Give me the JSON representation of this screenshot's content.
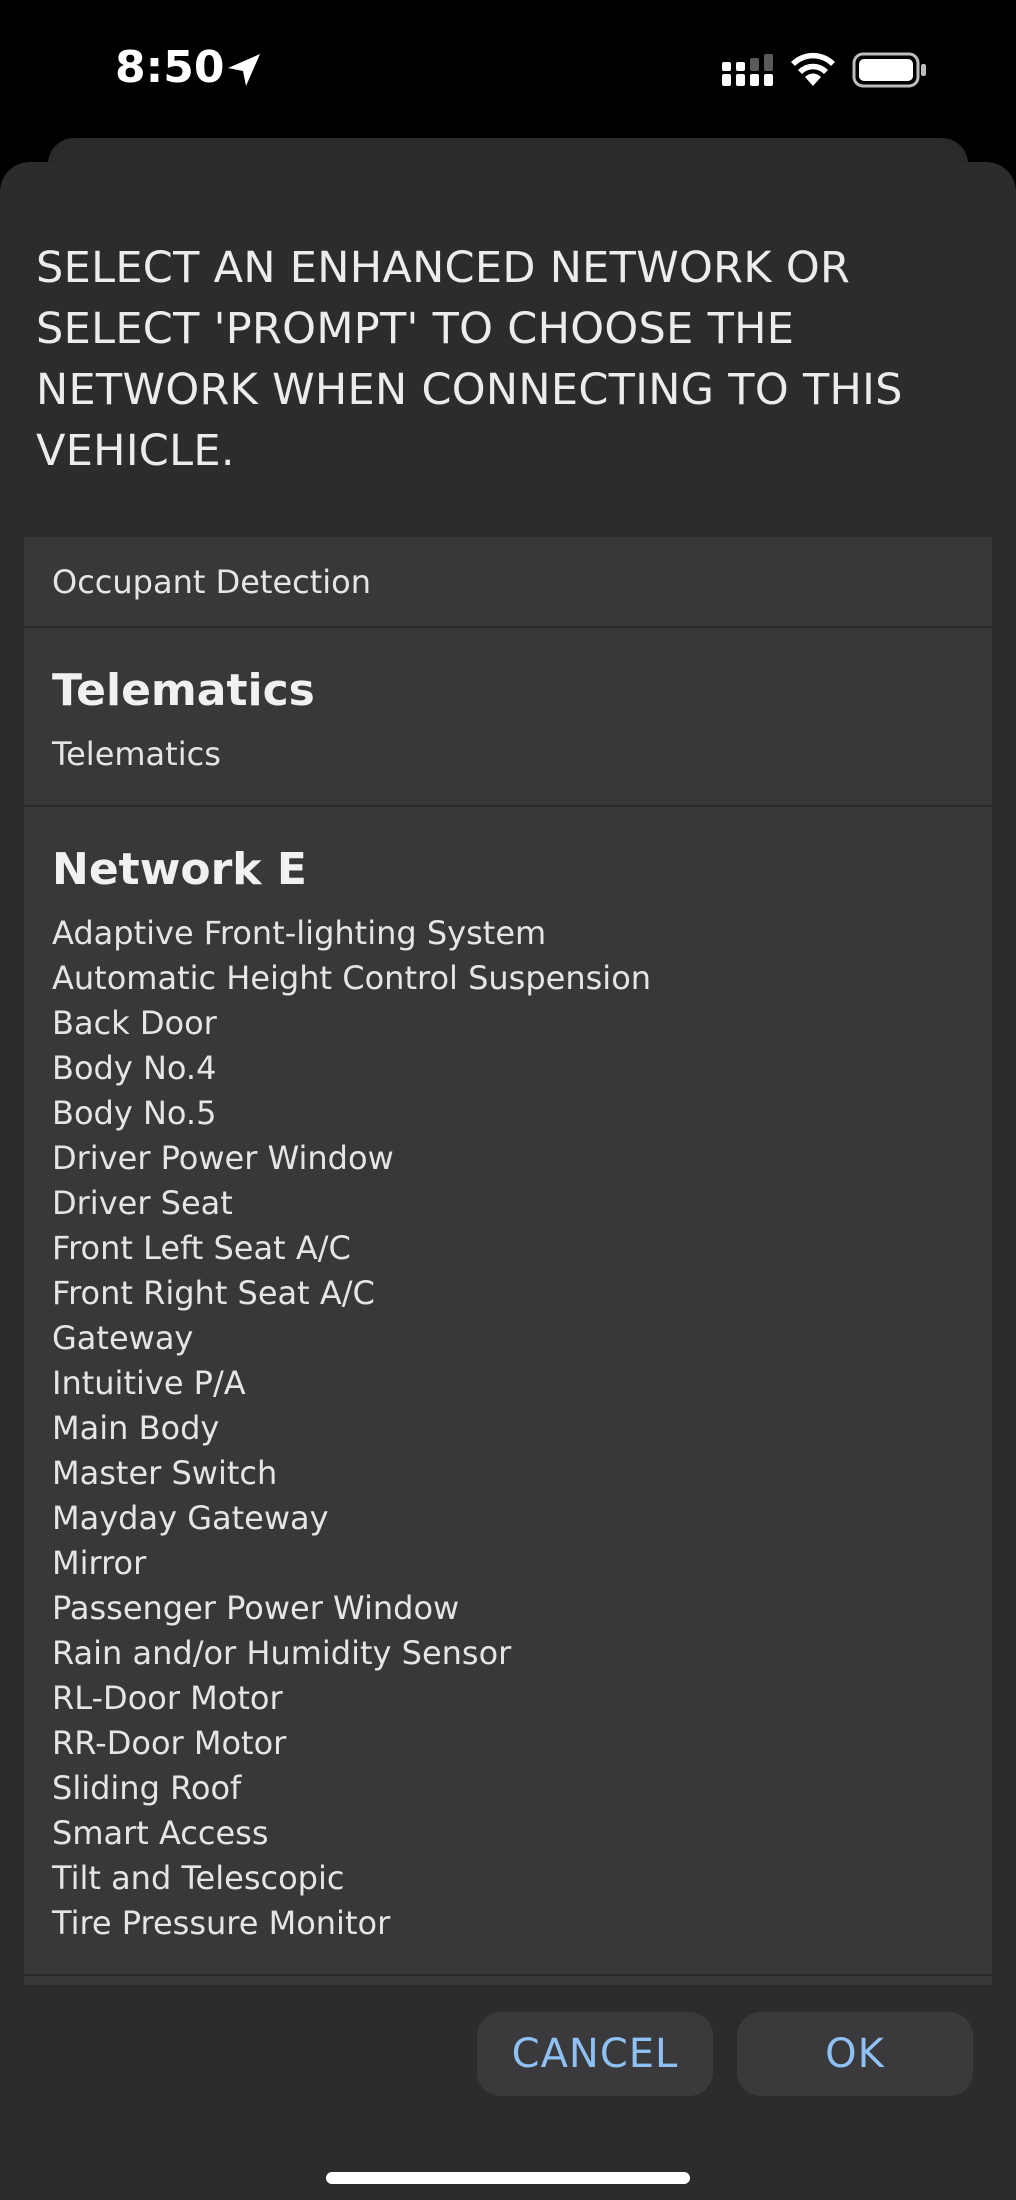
{
  "status_bar": {
    "time": "8:50",
    "icons": [
      "location-arrow-icon",
      "cellular-signal-icon",
      "wifi-icon",
      "battery-icon"
    ]
  },
  "dialog": {
    "prompt": "SELECT AN ENHANCED NETWORK OR SELECT 'PROMPT' TO CHOOSE THE NETWORK WHEN CONNECTING TO THIS VEHICLE.",
    "top_item": "Occupant Detection",
    "groups": [
      {
        "title": "Telematics",
        "items": [
          "Telematics"
        ]
      },
      {
        "title": "Network E",
        "items": [
          "Adaptive Front-lighting System",
          "Automatic Height Control Suspension",
          "Back Door",
          "Body No.4",
          "Body No.5",
          "Driver Power Window",
          "Driver Seat",
          "Front Left Seat A/C",
          "Front Right Seat A/C",
          "Gateway",
          "Intuitive P/A",
          "Main Body",
          "Master Switch",
          "Mayday Gateway",
          "Mirror",
          "Passenger Power Window",
          "Rain and/or Humidity Sensor",
          "RL-Door Motor",
          "RR-Door Motor",
          "Sliding Roof",
          "Smart Access",
          "Tilt and Telescopic",
          "Tire Pressure Monitor"
        ]
      }
    ],
    "cancel_label": "CANCEL",
    "ok_label": "OK"
  },
  "colors": {
    "background": "#000000",
    "sheet": "#2c2c2d",
    "list_bg": "#383839",
    "button_bg": "#3a3a3c",
    "button_text": "#8fc1f5"
  }
}
